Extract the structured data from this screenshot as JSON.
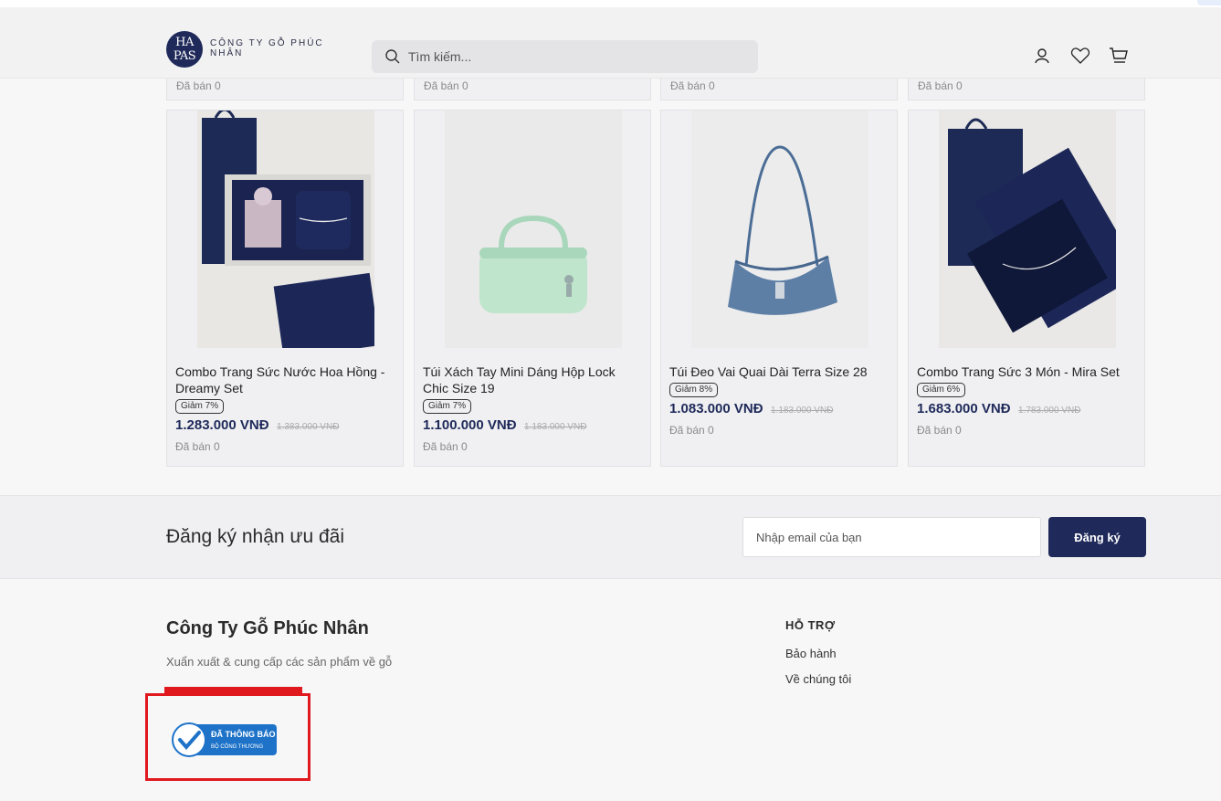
{
  "header": {
    "logo_mark": "HA PAS",
    "logo_line1": "CÔNG TY GỖ PHÚC",
    "logo_line2": "NHÂN",
    "search_placeholder": "Tìm kiếm...",
    "icons": [
      "user-icon",
      "heart-icon",
      "cart-icon"
    ]
  },
  "previous_row": {
    "sold_labels": [
      "Đã bán 0",
      "Đã bán 0",
      "Đã bán 0",
      "Đã bán 0"
    ]
  },
  "products": [
    {
      "name": "Combo Trang Sức Nước Hoa Hồng - Dreamy Set",
      "discount": "Giảm 7%",
      "price": "1.283.000 VNĐ",
      "old_price": "1.383.000 VNĐ",
      "sold": "Đã bán 0",
      "image": "jewelry-perfume-gift-set"
    },
    {
      "name": "Túi Xách Tay Mini Dáng Hộp Lock Chic Size 19",
      "discount": "Giảm 7%",
      "price": "1.100.000 VNĐ",
      "old_price": "1.183.000 VNĐ",
      "sold": "Đã bán 0",
      "image": "mint-green-handbag"
    },
    {
      "name": "Túi Đeo Vai Quai Dài Terra Size 28",
      "discount": "Giảm 8%",
      "price": "1.083.000 VNĐ",
      "old_price": "1.183.000 VNĐ",
      "sold": "Đã bán 0",
      "image": "denim-shoulder-bag"
    },
    {
      "name": "Combo Trang Sức 3 Món - Mira Set",
      "discount": "Giảm 6%",
      "price": "1.683.000 VNĐ",
      "old_price": "1.783.000 VNĐ",
      "sold": "Đã bán 0",
      "image": "jewelry-gift-box"
    }
  ],
  "newsletter": {
    "title": "Đăng ký nhận ưu đãi",
    "email_placeholder": "Nhập email của bạn",
    "button_label": "Đăng ký"
  },
  "footer": {
    "company_name": "Công Ty Gỗ Phúc Nhân",
    "company_desc": "Xuẩn xuất & cung cấp các sản phẩm về gỗ",
    "badge_line1": "ĐÃ THÔNG BÁO",
    "badge_line2": "BỘ CÔNG THƯƠNG",
    "support_title": "HỖ TRỢ",
    "support_links": [
      "Bảo hành",
      "Về chúng tôi"
    ]
  },
  "colors": {
    "brand_navy": "#1f2a5a",
    "highlight_red": "#e0191e",
    "card_bg": "#f0f0f2"
  }
}
